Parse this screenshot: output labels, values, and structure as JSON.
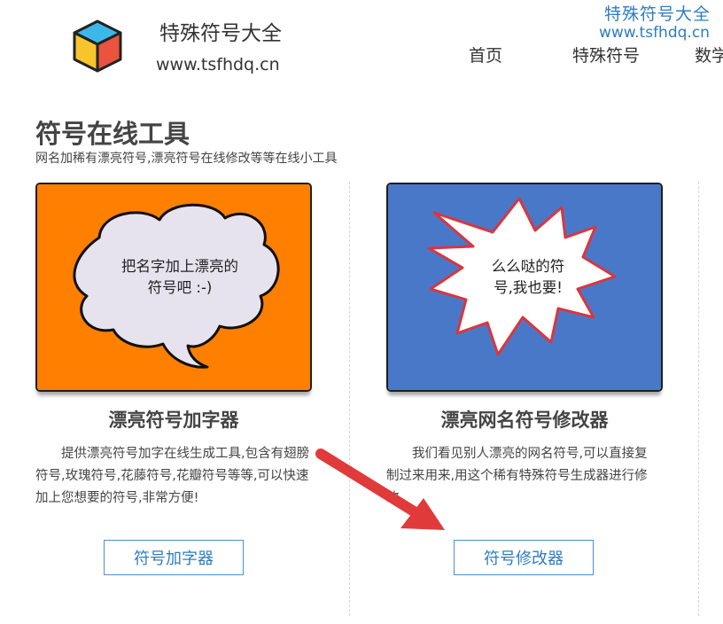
{
  "header": {
    "site_name": "特殊符号大全",
    "site_url": "www.tsfhdq.cn",
    "nav": [
      "首页",
      "特殊符号",
      "数学"
    ]
  },
  "watermark": {
    "title": "特殊符号大全",
    "url": "www.tsfhdq.cn"
  },
  "section": {
    "title": "符号在线工具",
    "subtitle": "网名加稀有漂亮符号,漂亮符号在线修改等等在线小工具"
  },
  "cards": [
    {
      "bubble_line1": "把名字加上漂亮的",
      "bubble_line2": "符号吧 :-)",
      "title": "漂亮符号加字器",
      "description": "提供漂亮符号加字在线生成工具,包含有翅膀符号,玫瑰符号,花藤符号,花瓣符号等等,可以快速加上您想要的符号,非常方便!",
      "button": "符号加字器",
      "bg_color": "#ff7f00"
    },
    {
      "bubble_line1": "么么哒的符",
      "bubble_line2": "号,我也要!",
      "title": "漂亮网名符号修改器",
      "description": "我们看见别人漂亮的网名符号,可以直接复制过来用来,用这个稀有特殊符号生成器进行修改",
      "button": "符号修改器",
      "bg_color": "#4a78c8"
    }
  ],
  "colors": {
    "accent": "#2e7cc3",
    "arrow": "#e03a3a"
  }
}
